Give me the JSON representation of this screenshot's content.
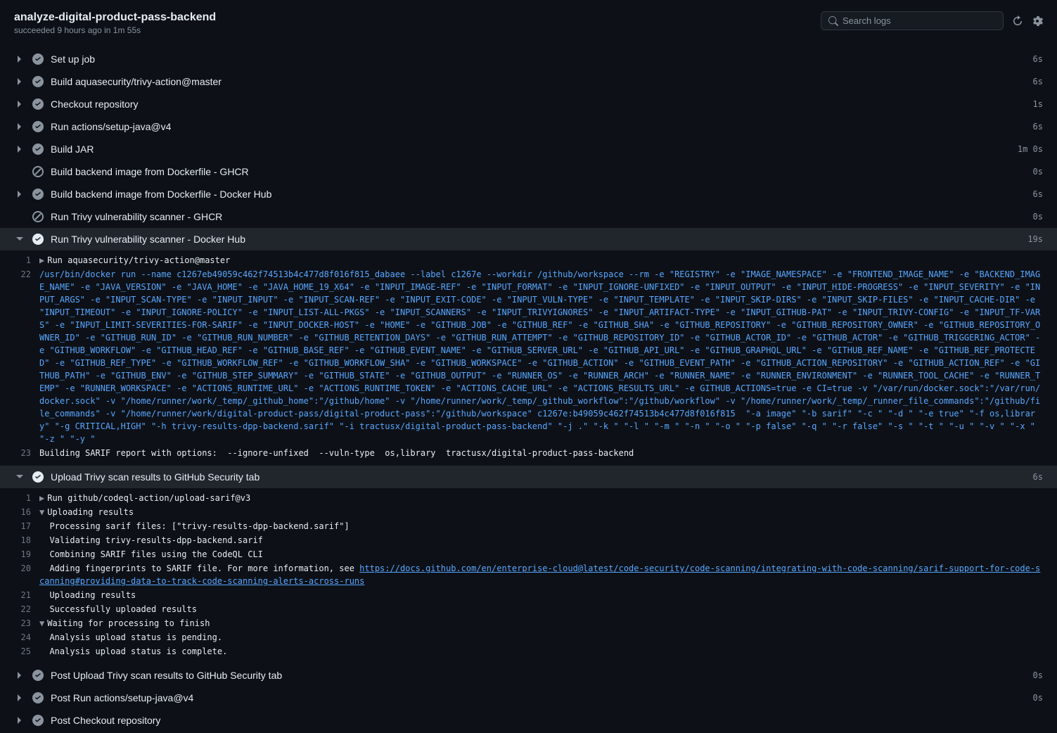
{
  "header": {
    "title": "analyze-digital-product-pass-backend",
    "subtitle": "succeeded 9 hours ago in 1m 55s",
    "search_placeholder": "Search logs"
  },
  "steps": {
    "s0": {
      "name": "Set up job",
      "duration": "6s",
      "status": "success",
      "chev": ">"
    },
    "s1": {
      "name": "Build aquasecurity/trivy-action@master",
      "duration": "6s",
      "status": "success",
      "chev": ">"
    },
    "s2": {
      "name": "Checkout repository",
      "duration": "1s",
      "status": "success",
      "chev": ">"
    },
    "s3": {
      "name": "Run actions/setup-java@v4",
      "duration": "6s",
      "status": "success",
      "chev": ">"
    },
    "s4": {
      "name": "Build JAR",
      "duration": "1m 0s",
      "status": "success",
      "chev": ">"
    },
    "s5": {
      "name": "Build backend image from Dockerfile - GHCR",
      "duration": "0s",
      "status": "skipped",
      "chev": ""
    },
    "s6": {
      "name": "Build backend image from Dockerfile - Docker Hub",
      "duration": "6s",
      "status": "success",
      "chev": ">"
    },
    "s7": {
      "name": "Run Trivy vulnerability scanner - GHCR",
      "duration": "0s",
      "status": "skipped",
      "chev": ""
    },
    "s8": {
      "name": "Run Trivy vulnerability scanner - Docker Hub",
      "duration": "19s",
      "status": "success",
      "chev": "v"
    },
    "s9": {
      "name": "Upload Trivy scan results to GitHub Security tab",
      "duration": "6s",
      "status": "success",
      "chev": "v"
    },
    "s10": {
      "name": "Post Upload Trivy scan results to GitHub Security tab",
      "duration": "0s",
      "status": "success",
      "chev": ">"
    },
    "s11": {
      "name": "Post Run actions/setup-java@v4",
      "duration": "0s",
      "status": "success",
      "chev": ">"
    },
    "s12": {
      "name": "Post Checkout repository",
      "duration": "",
      "status": "success",
      "chev": ">"
    }
  },
  "log": {
    "trivy": {
      "l1_no": "1",
      "l1": "Run aquasecurity/trivy-action@master",
      "l22_no": "22",
      "l22": "/usr/bin/docker run --name c1267eb49059c462f74513b4c477d8f016f815_dabaee --label c1267e --workdir /github/workspace --rm -e \"REGISTRY\" -e \"IMAGE_NAMESPACE\" -e \"FRONTEND_IMAGE_NAME\" -e \"BACKEND_IMAGE_NAME\" -e \"JAVA_VERSION\" -e \"JAVA_HOME\" -e \"JAVA_HOME_19_X64\" -e \"INPUT_IMAGE-REF\" -e \"INPUT_FORMAT\" -e \"INPUT_IGNORE-UNFIXED\" -e \"INPUT_OUTPUT\" -e \"INPUT_HIDE-PROGRESS\" -e \"INPUT_SEVERITY\" -e \"INPUT_ARGS\" -e \"INPUT_SCAN-TYPE\" -e \"INPUT_INPUT\" -e \"INPUT_SCAN-REF\" -e \"INPUT_EXIT-CODE\" -e \"INPUT_VULN-TYPE\" -e \"INPUT_TEMPLATE\" -e \"INPUT_SKIP-DIRS\" -e \"INPUT_SKIP-FILES\" -e \"INPUT_CACHE-DIR\" -e \"INPUT_TIMEOUT\" -e \"INPUT_IGNORE-POLICY\" -e \"INPUT_LIST-ALL-PKGS\" -e \"INPUT_SCANNERS\" -e \"INPUT_TRIVYIGNORES\" -e \"INPUT_ARTIFACT-TYPE\" -e \"INPUT_GITHUB-PAT\" -e \"INPUT_TRIVY-CONFIG\" -e \"INPUT_TF-VARS\" -e \"INPUT_LIMIT-SEVERITIES-FOR-SARIF\" -e \"INPUT_DOCKER-HOST\" -e \"HOME\" -e \"GITHUB_JOB\" -e \"GITHUB_REF\" -e \"GITHUB_SHA\" -e \"GITHUB_REPOSITORY\" -e \"GITHUB_REPOSITORY_OWNER\" -e \"GITHUB_REPOSITORY_OWNER_ID\" -e \"GITHUB_RUN_ID\" -e \"GITHUB_RUN_NUMBER\" -e \"GITHUB_RETENTION_DAYS\" -e \"GITHUB_RUN_ATTEMPT\" -e \"GITHUB_REPOSITORY_ID\" -e \"GITHUB_ACTOR_ID\" -e \"GITHUB_ACTOR\" -e \"GITHUB_TRIGGERING_ACTOR\" -e \"GITHUB_WORKFLOW\" -e \"GITHUB_HEAD_REF\" -e \"GITHUB_BASE_REF\" -e \"GITHUB_EVENT_NAME\" -e \"GITHUB_SERVER_URL\" -e \"GITHUB_API_URL\" -e \"GITHUB_GRAPHQL_URL\" -e \"GITHUB_REF_NAME\" -e \"GITHUB_REF_PROTECTED\" -e \"GITHUB_REF_TYPE\" -e \"GITHUB_WORKFLOW_REF\" -e \"GITHUB_WORKFLOW_SHA\" -e \"GITHUB_WORKSPACE\" -e \"GITHUB_ACTION\" -e \"GITHUB_EVENT_PATH\" -e \"GITHUB_ACTION_REPOSITORY\" -e \"GITHUB_ACTION_REF\" -e \"GITHUB_PATH\" -e \"GITHUB_ENV\" -e \"GITHUB_STEP_SUMMARY\" -e \"GITHUB_STATE\" -e \"GITHUB_OUTPUT\" -e \"RUNNER_OS\" -e \"RUNNER_ARCH\" -e \"RUNNER_NAME\" -e \"RUNNER_ENVIRONMENT\" -e \"RUNNER_TOOL_CACHE\" -e \"RUNNER_TEMP\" -e \"RUNNER_WORKSPACE\" -e \"ACTIONS_RUNTIME_URL\" -e \"ACTIONS_RUNTIME_TOKEN\" -e \"ACTIONS_CACHE_URL\" -e \"ACTIONS_RESULTS_URL\" -e GITHUB_ACTIONS=true -e CI=true -v \"/var/run/docker.sock\":\"/var/run/docker.sock\" -v \"/home/runner/work/_temp/_github_home\":\"/github/home\" -v \"/home/runner/work/_temp/_github_workflow\":\"/github/workflow\" -v \"/home/runner/work/_temp/_runner_file_commands\":\"/github/file_commands\" -v \"/home/runner/work/digital-product-pass/digital-product-pass\":\"/github/workspace\" c1267e:b49059c462f74513b4c477d8f016f815  \"-a image\" \"-b sarif\" \"-c \" \"-d \" \"-e true\" \"-f os,library\" \"-g CRITICAL,HIGH\" \"-h trivy-results-dpp-backend.sarif\" \"-i tractusx/digital-product-pass-backend\" \"-j .\" \"-k \" \"-l \" \"-m \" \"-n \" \"-o \" \"-p false\" \"-q \" \"-r false\" \"-s \" \"-t \" \"-u \" \"-v \" \"-x \" \"-z \" \"-y \"",
      "l23_no": "23",
      "l23": "Building SARIF report with options:  --ignore-unfixed  --vuln-type  os,library  tractusx/digital-product-pass-backend"
    },
    "upload": {
      "l1_no": "1",
      "l1": "Run github/codeql-action/upload-sarif@v3",
      "l16_no": "16",
      "l16": "Uploading results",
      "l17_no": "17",
      "l17": "  Processing sarif files: [\"trivy-results-dpp-backend.sarif\"]",
      "l18_no": "18",
      "l18": "  Validating trivy-results-dpp-backend.sarif",
      "l19_no": "19",
      "l19": "  Combining SARIF files using the CodeQL CLI",
      "l20_no": "20",
      "l20_pre": "  Adding fingerprints to SARIF file. For more information, see ",
      "l20_link": "https://docs.github.com/en/enterprise-cloud@latest/code-security/code-scanning/integrating-with-code-scanning/sarif-support-for-code-scanning#providing-data-to-track-code-scanning-alerts-across-runs",
      "l21_no": "21",
      "l21": "  Uploading results",
      "l22_no": "22",
      "l22": "  Successfully uploaded results",
      "l23_no": "23",
      "l23": "Waiting for processing to finish",
      "l24_no": "24",
      "l24": "  Analysis upload status is pending.",
      "l25_no": "25",
      "l25": "  Analysis upload status is complete."
    }
  }
}
